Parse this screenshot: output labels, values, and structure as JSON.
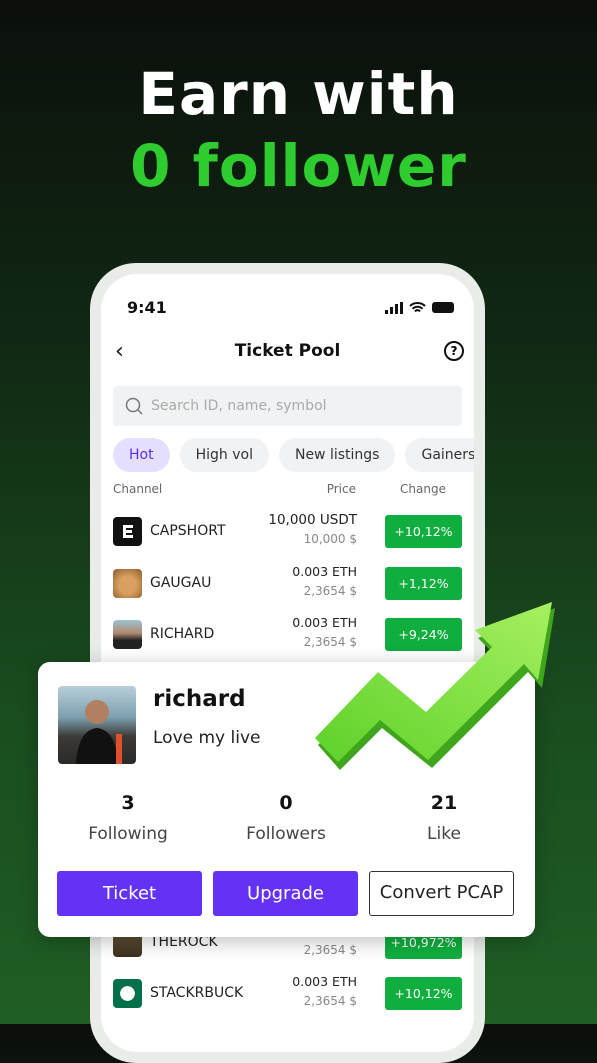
{
  "headline": {
    "line1": "Earn with",
    "line2": "0 follower"
  },
  "status_bar": {
    "time": "9:41",
    "icons": [
      "signal-icon",
      "wifi-icon",
      "battery-icon"
    ]
  },
  "header": {
    "title": "Ticket Pool",
    "back_icon": "chevron-left-icon",
    "help_icon": "question-circle-icon",
    "help_glyph": "?"
  },
  "search": {
    "placeholder": "Search ID, name, symbol"
  },
  "tabs": [
    {
      "label": "Hot",
      "active": true
    },
    {
      "label": "High vol"
    },
    {
      "label": "New listings"
    },
    {
      "label": "Gainers"
    }
  ],
  "columns": {
    "channel": "Channel",
    "price": "Price",
    "change": "Change"
  },
  "rows": [
    {
      "name": "CAPSHORT",
      "price": "10,000 USDT",
      "usd": "10,000 $",
      "change": "+10,12%"
    },
    {
      "name": "GAUGAU",
      "price": "0.003 ETH",
      "usd": "2,3654 $",
      "change": "+1,12%"
    },
    {
      "name": "RICHARD",
      "price": "0.003 ETH",
      "usd": "2,3654 $",
      "change": "+9,24%"
    },
    {
      "name": "THEROCK",
      "price": "",
      "usd": "2,3654 $",
      "change": "+10,972%"
    },
    {
      "name": "STACKRBUCK",
      "price": "0.003 ETH",
      "usd": "2,3654 $",
      "change": "+10,12%"
    }
  ],
  "profile": {
    "username": "richard",
    "bio": "Love my live",
    "stats": [
      {
        "value": "3",
        "label": "Following"
      },
      {
        "value": "0",
        "label": "Followers"
      },
      {
        "value": "21",
        "label": "Like"
      }
    ],
    "buttons": {
      "ticket": "Ticket",
      "upgrade": "Upgrade",
      "convert": "Convert PCAP"
    }
  },
  "colors": {
    "accent_green": "#2ecc2e",
    "change_green": "#0fae3e",
    "primary_purple": "#6432f5"
  }
}
